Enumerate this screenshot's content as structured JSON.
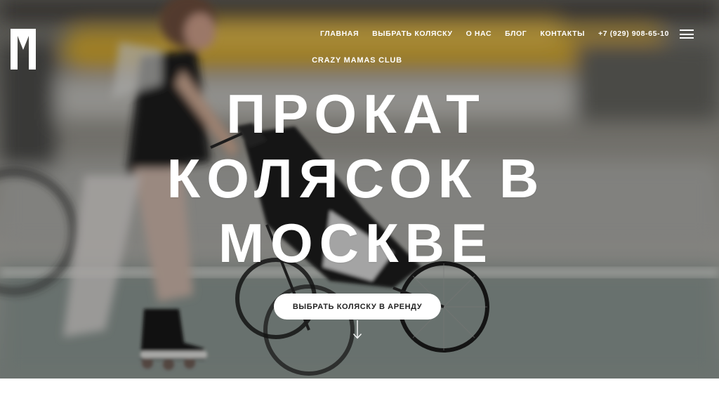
{
  "header": {
    "logo_icon": "m-dots-logo-icon",
    "nav": [
      {
        "label": "ГЛАВНАЯ"
      },
      {
        "label": "ВЫБРАТЬ КОЛЯСКУ"
      },
      {
        "label": "О НАС"
      },
      {
        "label": "БЛОГ"
      },
      {
        "label": "КОНТАКТЫ"
      },
      {
        "label": "+7 (929) 908-65-10"
      }
    ],
    "menu_icon": "hamburger-icon"
  },
  "hero": {
    "kicker": "CRAZY MAMAS CLUB",
    "title_lines": [
      "ПРОКАТ",
      "КОЛЯСОК В",
      "МОСКВЕ"
    ],
    "cta_label": "ВЫБРАТЬ КОЛЯСКУ В АРЕНДУ",
    "scroll_icon": "arrow-down-icon",
    "background": "blurred photo of a woman on roller skates pushing a jogging stroller on a city street"
  },
  "colors": {
    "text": "#ffffff",
    "button_bg": "#ffffff",
    "button_text": "#222222",
    "page_bg": "#ffffff"
  }
}
